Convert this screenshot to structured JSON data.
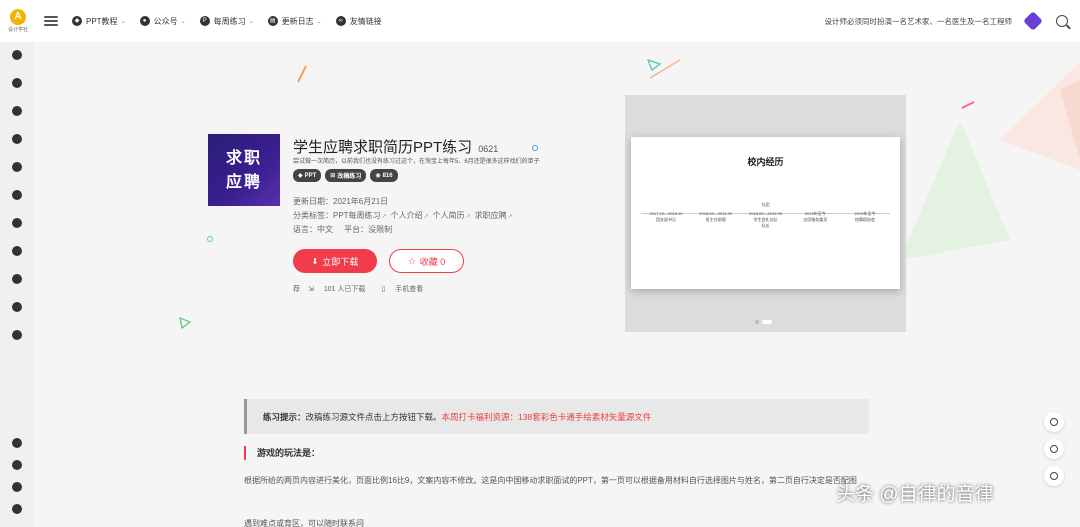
{
  "brand": {
    "logo_letter": "A",
    "logo_text": "设计学社"
  },
  "nav": [
    {
      "icon": "ppt-icon",
      "glyph": "◆",
      "label": "PPT教程",
      "dropdown": true
    },
    {
      "icon": "wechat-icon",
      "glyph": "●",
      "label": "公众号",
      "dropdown": true
    },
    {
      "icon": "practice-icon",
      "glyph": "P",
      "label": "每周练习",
      "dropdown": true
    },
    {
      "icon": "log-icon",
      "glyph": "▤",
      "label": "更新日志",
      "dropdown": true
    },
    {
      "icon": "link-icon",
      "glyph": "∞",
      "label": "友情链接",
      "dropdown": false
    }
  ],
  "header_right": {
    "slogan": "设计师必须同时扮演一名艺术家、一名医生及一名工程师"
  },
  "product": {
    "thumb_text": "求职\n应聘",
    "title": "学生应聘求职简历PPT练习",
    "code": "0621",
    "subtitle": "尝试做一次简历，以前我们也没有练习过这个，在淘宝上每年5、6月还是很多这样找们的单子",
    "tags": [
      {
        "glyph": "◆",
        "label": "PPT"
      },
      {
        "glyph": "⊞",
        "label": "改稿练习"
      },
      {
        "glyph": "◉",
        "label": "816"
      }
    ],
    "date_label": "更新日期：",
    "date_value": "2021年6月21日",
    "category_label": "分类标签：",
    "categories": [
      "PPT每周练习",
      "个人介绍",
      "个人简历",
      "求职应聘"
    ],
    "lang_label": "语言：",
    "lang_value": "中文",
    "platform_label": "平台：",
    "platform_value": "没限制",
    "download_label": "立即下载",
    "collect_label": "收藏 0",
    "stat_tag": "荐",
    "stat_downloads": "101 人已下载",
    "stat_mobile": "手机查看"
  },
  "preview": {
    "slide_title": "校内经历",
    "center_label": "社团",
    "timeline": [
      {
        "date": "2017.10—2018.10",
        "desc": "团支部书记"
      },
      {
        "date": "2018.09—2019.09",
        "desc": "班主任助理"
      },
      {
        "date": "2018.09—2019.09",
        "desc": "学生会礼仪队\n队长"
      },
      {
        "date": "2019年至今",
        "desc": "志愿服务委员"
      },
      {
        "date": "2019年至今",
        "desc": "校舞蹈协会"
      }
    ]
  },
  "tip": {
    "label": "练习提示：",
    "text": "改稿练习源文件点击上方按钮下载。",
    "red1": "本周打卡福利资源：",
    "red2": "138套彩色卡通手绘素材矢量源文件"
  },
  "section": {
    "heading": "游戏的玩法是：",
    "paragraph": "根据所给的两页内容进行美化，页面比例16比9，文案内容不修改。这是向中国移动求职面试的PPT，第一页可以根据备用材料自行选择图片与姓名，第二页自行决定是否配图",
    "paragraph2": "遇到难点或育区，可以随时联系问"
  },
  "watermark": "头条 @自律的音律",
  "colors": {
    "accent": "#f03c4b",
    "thumb_bg": "#2a1d78",
    "hex_badge": "#6b3fd6"
  }
}
